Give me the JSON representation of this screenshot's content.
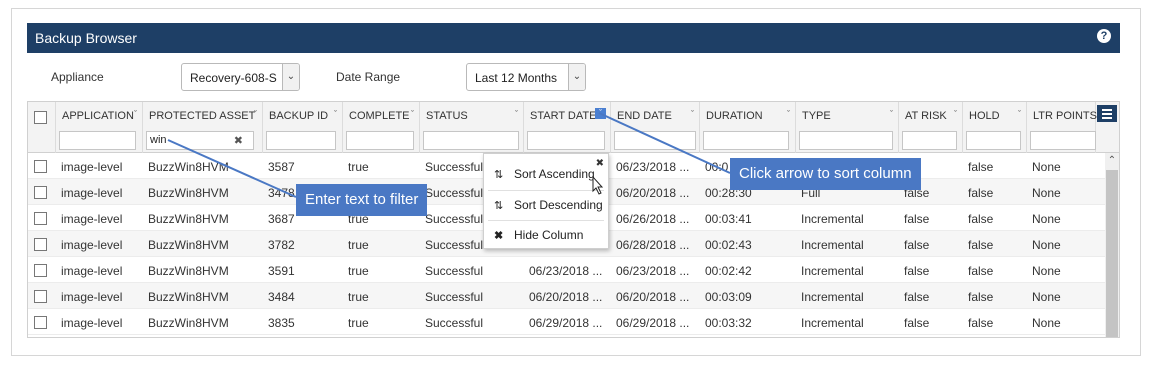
{
  "panel": {
    "title": "Backup Browser",
    "help_glyph": "?"
  },
  "filters": {
    "appliance_label": "Appliance",
    "appliance_value": "Recovery-608-S",
    "date_range_label": "Date Range",
    "date_range_value": "Last 12 Months"
  },
  "columns": [
    {
      "label": "APPLICATION",
      "filter": ""
    },
    {
      "label": "PROTECTED ASSET",
      "filter": "win"
    },
    {
      "label": "BACKUP ID",
      "filter": ""
    },
    {
      "label": "COMPLETE",
      "filter": ""
    },
    {
      "label": "STATUS",
      "filter": ""
    },
    {
      "label": "START DATE",
      "filter": ""
    },
    {
      "label": "END DATE",
      "filter": ""
    },
    {
      "label": "DURATION",
      "filter": ""
    },
    {
      "label": "TYPE",
      "filter": ""
    },
    {
      "label": "AT RISK",
      "filter": ""
    },
    {
      "label": "HOLD",
      "filter": ""
    },
    {
      "label": "LTR POINTS",
      "filter": ""
    }
  ],
  "rows": [
    [
      "image-level",
      "BuzzWin8HVM",
      "3587",
      "true",
      "Successful",
      "",
      "06/23/2018 ...",
      "00:0",
      "",
      "",
      "false",
      "None"
    ],
    [
      "image-level",
      "BuzzWin8HVM",
      "3478",
      "true",
      "Successful",
      "",
      "06/20/2018 ...",
      "00:28:30",
      "Full",
      "false",
      "false",
      "None"
    ],
    [
      "image-level",
      "BuzzWin8HVM",
      "3687",
      "true",
      "Successful",
      "",
      "06/26/2018 ...",
      "00:03:41",
      "Incremental",
      "false",
      "false",
      "None"
    ],
    [
      "image-level",
      "BuzzWin8HVM",
      "3782",
      "true",
      "Successful",
      "",
      "06/28/2018 ...",
      "00:02:43",
      "Incremental",
      "false",
      "false",
      "None"
    ],
    [
      "image-level",
      "BuzzWin8HVM",
      "3591",
      "true",
      "Successful",
      "06/23/2018 ...",
      "06/23/2018 ...",
      "00:02:42",
      "Incremental",
      "false",
      "false",
      "None"
    ],
    [
      "image-level",
      "BuzzWin8HVM",
      "3484",
      "true",
      "Successful",
      "06/20/2018 ...",
      "06/20/2018 ...",
      "00:03:09",
      "Incremental",
      "false",
      "false",
      "None"
    ],
    [
      "image-level",
      "BuzzWin8HVM",
      "3835",
      "true",
      "Successful",
      "06/29/2018 ...",
      "06/29/2018 ...",
      "00:03:32",
      "Incremental",
      "false",
      "false",
      "None"
    ]
  ],
  "context_menu": {
    "sort_ascending": "Sort Ascending",
    "sort_descending": "Sort Descending",
    "hide_column": "Hide Column",
    "close_glyph": "✖"
  },
  "callouts": {
    "filter_hint": "Enter text to filter",
    "sort_hint": "Click arrow to sort column"
  },
  "colors": {
    "header_bar": "#1e3f66",
    "callout": "#4a78c4"
  }
}
